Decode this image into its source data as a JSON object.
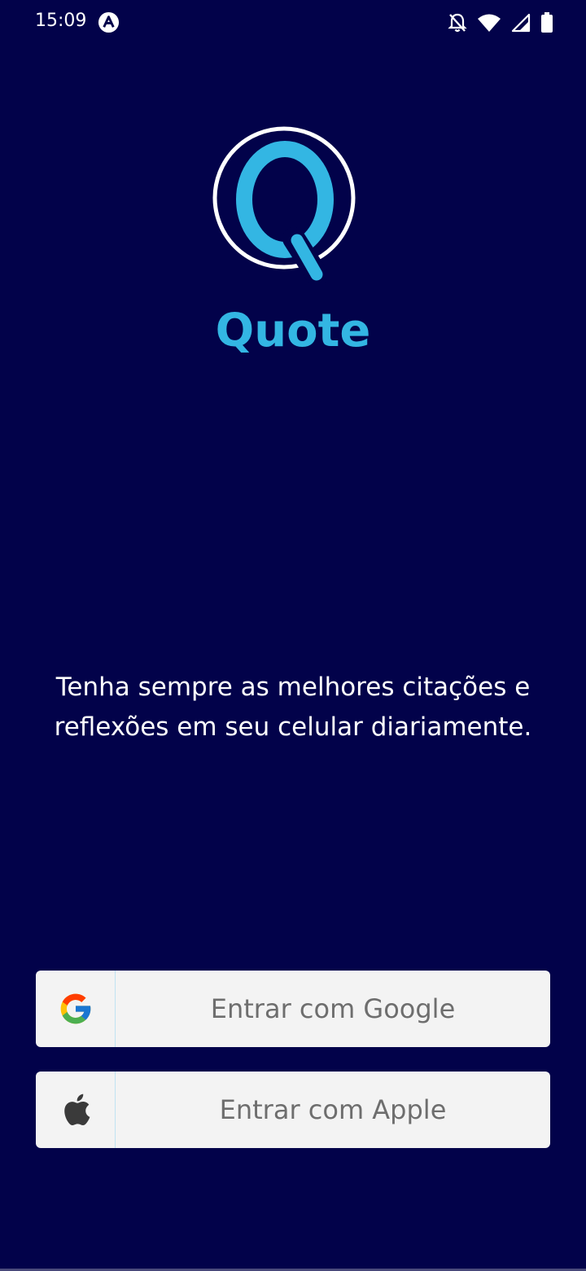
{
  "status_bar": {
    "time": "15:09",
    "app_icon": "font-a-icon",
    "icons": [
      "bell-off-icon",
      "wifi-icon",
      "signal-icon",
      "battery-icon"
    ]
  },
  "app": {
    "name": "Quote",
    "logo_letter": "Q",
    "accent_color": "#33b6e3",
    "background_color": "#02024a"
  },
  "tagline": "Tenha sempre as melhores citações e reflexões em seu celular diariamente.",
  "buttons": {
    "google_label": "Entrar com Google",
    "apple_label": "Entrar com Apple",
    "google_icon": "google-icon",
    "apple_icon": "apple-icon"
  }
}
